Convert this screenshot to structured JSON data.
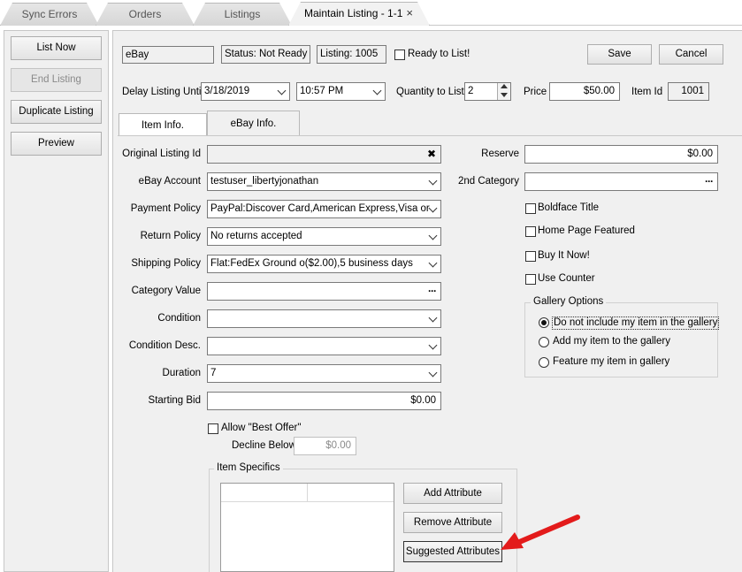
{
  "tabs": {
    "sync_errors": "Sync Errors",
    "orders": "Orders",
    "listings": "Listings",
    "maintain": "Maintain Listing - 1-1",
    "close": "×"
  },
  "sidebar": {
    "list_now": "List Now",
    "end_listing": "End Listing",
    "duplicate": "Duplicate Listing",
    "preview": "Preview"
  },
  "header": {
    "platform": "eBay",
    "status": "Status: Not Ready",
    "listing": "Listing: 1005",
    "ready_label": "Ready to List!",
    "save": "Save",
    "cancel": "Cancel"
  },
  "row2": {
    "delay_label": "Delay Listing Until",
    "date": "3/18/2019",
    "time": "10:57 PM",
    "qty_label": "Quantity to List",
    "qty": "2",
    "price_label": "Price",
    "price": "$50.00",
    "item_id_label": "Item Id",
    "item_id": "1001"
  },
  "inner_tabs": {
    "item_info": "Item Info.",
    "ebay_info": "eBay Info."
  },
  "form": {
    "original_listing_id_label": "Original Listing Id",
    "original_listing_id": "",
    "ebay_account_label": "eBay Account",
    "ebay_account": "testuser_libertyjonathan",
    "payment_policy_label": "Payment Policy",
    "payment_policy": "PayPal:Discover Card,American Express,Visa or",
    "return_policy_label": "Return Policy",
    "return_policy": "No returns accepted",
    "shipping_policy_label": "Shipping Policy",
    "shipping_policy": "Flat:FedEx Ground o($2.00),5 business days",
    "category_value_label": "Category Value",
    "category_value": "",
    "condition_label": "Condition",
    "condition": "",
    "condition_desc_label": "Condition Desc.",
    "condition_desc": "",
    "duration_label": "Duration",
    "duration": "7",
    "starting_bid_label": "Starting Bid",
    "starting_bid": "$0.00",
    "allow_best_offer": "Allow \"Best Offer\"",
    "decline_below_label": "Decline Below",
    "decline_below": "$0.00"
  },
  "right": {
    "reserve_label": "Reserve",
    "reserve": "$0.00",
    "second_category_label": "2nd Category",
    "second_category": "",
    "boldface": "Boldface Title",
    "home_page": "Home Page Featured",
    "buy_it_now": "Buy It Now!",
    "use_counter": "Use Counter",
    "gallery_title": "Gallery Options",
    "gallery_opt1": "Do not include my item in the gallery",
    "gallery_opt2": "Add my item to the gallery",
    "gallery_opt3": "Feature my item in gallery"
  },
  "specifics": {
    "title": "Item Specifics",
    "add": "Add Attribute",
    "remove": "Remove Attribute",
    "suggested": "Suggested Attributes"
  },
  "colors": {
    "arrow": "#e31b1b"
  }
}
